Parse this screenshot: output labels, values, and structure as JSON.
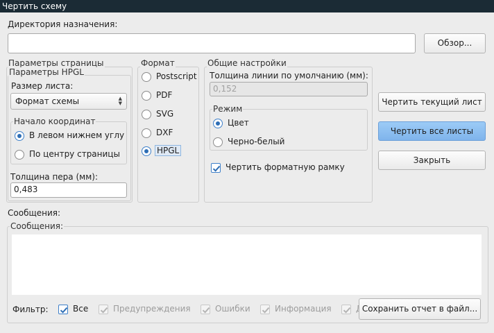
{
  "window": {
    "title": "Чертить схему"
  },
  "destination": {
    "label": "Директория назначения:",
    "value": "",
    "browse_button": "Обзор..."
  },
  "page_params": {
    "title": "Параметры страницы",
    "hpgl_title": "Параметры HPGL",
    "sheet_size_label": "Размер листа:",
    "sheet_size_value": "Формат схемы",
    "origin_title": "Начало координат",
    "origin_options": [
      "В левом нижнем углу",
      "По центру страницы"
    ],
    "origin_selected": 0,
    "pen_width_label": "Толщина пера (мм):",
    "pen_width_value": "0,483"
  },
  "format": {
    "title": "Формат",
    "options": [
      "Postscript",
      "PDF",
      "SVG",
      "DXF",
      "HPGL"
    ],
    "selected": 4
  },
  "general": {
    "title": "Общие настройки",
    "line_width_label": "Толщина линии по умолчанию (мм):",
    "line_width_value": "0,152",
    "mode_title": "Режим",
    "mode_options": [
      "Цвет",
      "Черно-белый"
    ],
    "mode_selected": 0,
    "frame_label": "Чертить форматную рамку",
    "frame_checked": true
  },
  "actions": {
    "plot_current": "Чертить текущий лист",
    "plot_all": "Чертить все листы",
    "close": "Закрыть"
  },
  "messages": {
    "label": "Сообщения:",
    "group_title": "Сообщения:",
    "filter_label": "Фильтр:",
    "filters": [
      {
        "label": "Все",
        "checked": true,
        "enabled": true
      },
      {
        "label": "Предупреждения",
        "checked": true,
        "enabled": false
      },
      {
        "label": "Ошибки",
        "checked": true,
        "enabled": false
      },
      {
        "label": "Информация",
        "checked": true,
        "enabled": false
      },
      {
        "label": "Д",
        "checked": true,
        "enabled": false
      }
    ],
    "save_button": "Сохранить отчет в файл..."
  },
  "colors": {
    "titlebar": "#1b2b35",
    "accent": "#2e6eb5",
    "primary_button": "#8cc0f2"
  }
}
